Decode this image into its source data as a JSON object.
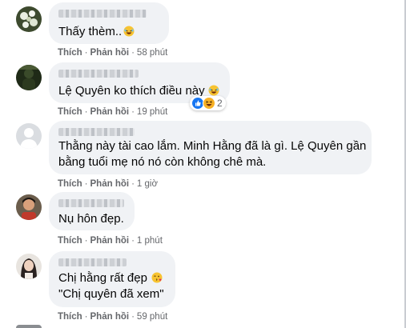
{
  "comments": [
    {
      "text": "Thấy thèm..",
      "emoji": "laughing-emoji",
      "like_label": "Thích",
      "reply_label": "Phản hồi",
      "time": "58 phút"
    },
    {
      "text": "Lệ Quyên ko thích điều này",
      "emoji": "laughing-emoji",
      "like_label": "Thích",
      "reply_label": "Phản hồi",
      "time": "19 phút",
      "reactions": {
        "icons": [
          "like-reaction-icon",
          "haha-reaction-icon"
        ],
        "count": "2"
      }
    },
    {
      "text_lines": [
        "Thằng này tài cao lắm. Minh Hằng đã là gì. Lệ Quyên gần",
        "bằng tuổi mẹ nó nó còn không chê mà."
      ],
      "like_label": "Thích",
      "reply_label": "Phản hồi",
      "time": "1 giờ"
    },
    {
      "text": "Nụ hôn đẹp.",
      "like_label": "Thích",
      "reply_label": "Phản hồi",
      "time": "1 phút"
    },
    {
      "text_lines": [
        "Chị hằng rất đẹp",
        "\"Chị quyên đã xem\""
      ],
      "emoji": "kissing-heart-emoji",
      "like_label": "Thích",
      "reply_label": "Phản hồi",
      "time": "59 phút"
    }
  ],
  "colors": {
    "bubble": "#f0f2f5",
    "meta_text": "#65676b",
    "like_blue": "#1877f2",
    "haha_yellow": "#f7b125"
  }
}
